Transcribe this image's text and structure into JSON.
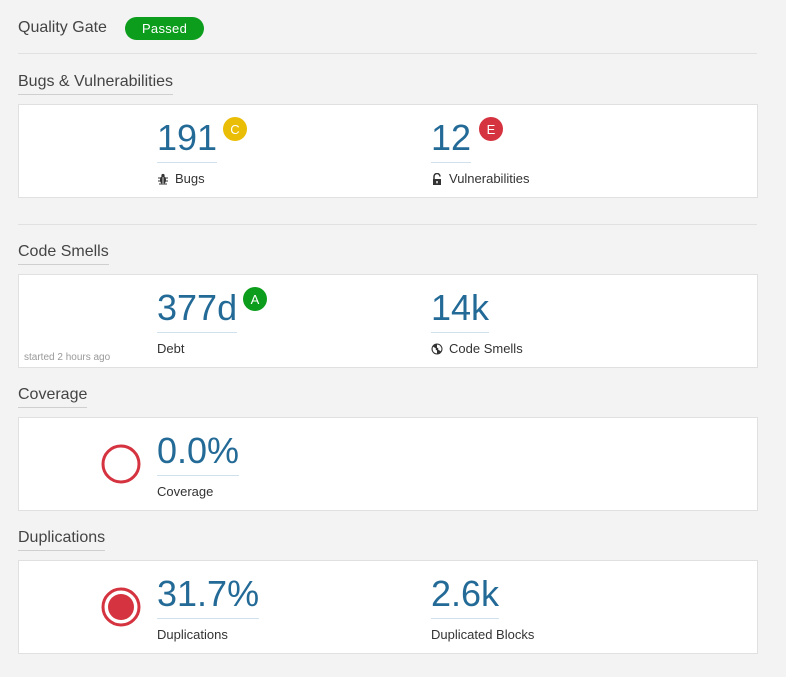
{
  "quality_gate": {
    "title": "Quality Gate",
    "status": "Passed",
    "status_color": "#0c9d1c"
  },
  "bugs_vulns": {
    "title": "Bugs & Vulnerabilities",
    "bugs": {
      "value": "191",
      "rating": "C",
      "rating_color": "#eabe06",
      "label": "Bugs",
      "icon": "bug-icon"
    },
    "vulnerabilities": {
      "value": "12",
      "rating": "E",
      "rating_color": "#d4333f",
      "label": "Vulnerabilities",
      "icon": "lock-icon"
    }
  },
  "code_smells": {
    "title": "Code Smells",
    "debt": {
      "value": "377d",
      "rating": "A",
      "rating_color": "#0c9d1c",
      "label": "Debt"
    },
    "smells": {
      "value": "14k",
      "label": "Code Smells",
      "icon": "code-smell-icon"
    },
    "note": "started 2 hours ago"
  },
  "coverage": {
    "title": "Coverage",
    "value": "0.0%",
    "label": "Coverage",
    "icon": "coverage-donut-icon",
    "icon_color": "#d4333f"
  },
  "duplications": {
    "title": "Duplications",
    "percent": {
      "value": "31.7%",
      "label": "Duplications",
      "icon": "duplications-donut-icon",
      "icon_color": "#d4333f"
    },
    "blocks": {
      "value": "2.6k",
      "label": "Duplicated Blocks"
    }
  }
}
